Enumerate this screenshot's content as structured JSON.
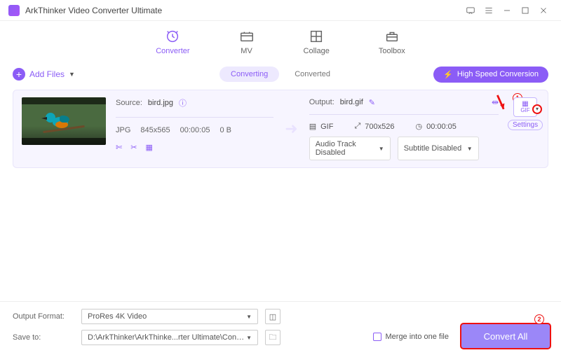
{
  "titlebar": {
    "title": "ArkThinker Video Converter Ultimate"
  },
  "tabs": {
    "converter": "Converter",
    "mv": "MV",
    "collage": "Collage",
    "toolbox": "Toolbox"
  },
  "toolbar": {
    "add_files": "Add Files",
    "hsc": "High Speed Conversion"
  },
  "subtabs": {
    "converting": "Converting",
    "converted": "Converted"
  },
  "item": {
    "source_label": "Source:",
    "source_name": "bird.jpg",
    "src_format": "JPG",
    "src_res": "845x565",
    "src_dur": "00:00:05",
    "src_size": "0 B",
    "output_label": "Output:",
    "output_name": "bird.gif",
    "out_format": "GIF",
    "out_res": "700x526",
    "out_dur": "00:00:05",
    "audio_sel": "Audio Track Disabled",
    "subtitle_sel": "Subtitle Disabled",
    "format_badge": "GIF",
    "settings": "Settings"
  },
  "footer": {
    "output_format_label": "Output Format:",
    "output_format_value": "ProRes 4K Video",
    "save_to_label": "Save to:",
    "save_to_value": "D:\\ArkThinker\\ArkThinke...rter Ultimate\\Converted",
    "merge": "Merge into one file",
    "convert": "Convert All"
  },
  "annotations": {
    "one": "1",
    "two": "2"
  }
}
